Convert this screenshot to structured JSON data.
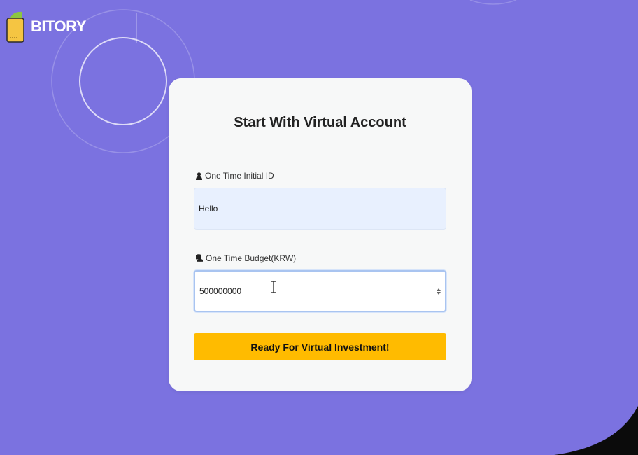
{
  "brand": {
    "name": "BITORY"
  },
  "card": {
    "title": "Start With Virtual Account"
  },
  "form": {
    "id_label": "One Time Initial ID",
    "id_value": "Hello",
    "budget_label": "One Time Budget(KRW)",
    "budget_value": "500000000",
    "submit_label": "Ready For Virtual Investment!"
  },
  "icons": {
    "id_icon": "user-icon",
    "budget_icon": "coins-icon",
    "logo_icon": "wallet-logo-icon",
    "spinner_icon": "number-spinner-icon",
    "cursor_icon": "text-cursor-icon"
  },
  "colors": {
    "background": "#7b72e0",
    "card": "#f7f8f8",
    "accent": "#ffbb00",
    "id_input_bg": "#e8f0fe",
    "focus_border": "#a9c4f0"
  }
}
